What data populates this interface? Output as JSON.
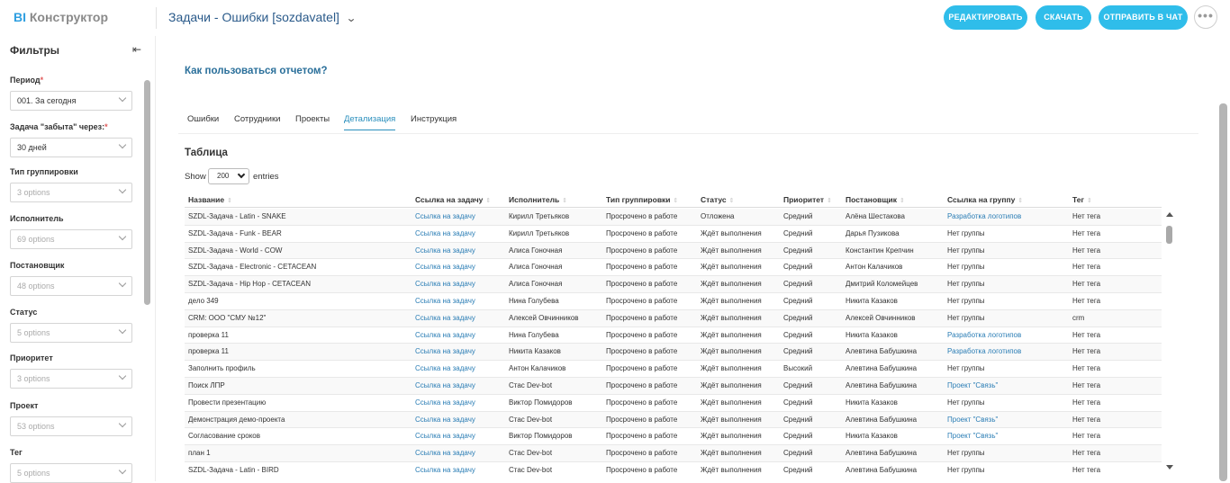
{
  "header": {
    "brand_bi": "BI",
    "brand_rest": " Конструктор",
    "report_title": "Задачи - Ошибки [sozdavatel]",
    "buttons": {
      "edit": "РЕДАКТИРОВАТЬ",
      "download": "СКАЧАТЬ",
      "send": "ОТПРАВИТЬ В ЧАТ"
    },
    "more": "•••"
  },
  "sidebar": {
    "title": "Фильтры",
    "filters": [
      {
        "label": "Период",
        "required": true,
        "value": "001. За сегодня",
        "placeholder": false
      },
      {
        "label": "Задача \"забыта\" через:",
        "required": true,
        "value": "30 дней",
        "placeholder": false
      },
      {
        "label": "Тип группировки",
        "required": false,
        "value": "3 options",
        "placeholder": true
      },
      {
        "label": "Исполнитель",
        "required": false,
        "value": "69 options",
        "placeholder": true
      },
      {
        "label": "Постановщик",
        "required": false,
        "value": "48 options",
        "placeholder": true
      },
      {
        "label": "Статус",
        "required": false,
        "value": "5 options",
        "placeholder": true
      },
      {
        "label": "Приоритет",
        "required": false,
        "value": "3 options",
        "placeholder": true
      },
      {
        "label": "Проект",
        "required": false,
        "value": "53 options",
        "placeholder": true
      },
      {
        "label": "Тег",
        "required": false,
        "value": "5 options",
        "placeholder": true
      }
    ]
  },
  "main": {
    "howto": "Как пользоваться отчетом?",
    "tabs": [
      {
        "label": "Ошибки",
        "active": false
      },
      {
        "label": "Сотрудники",
        "active": false
      },
      {
        "label": "Проекты",
        "active": false
      },
      {
        "label": "Детализация",
        "active": true
      },
      {
        "label": "Инструкция",
        "active": false
      }
    ],
    "table_title": "Таблица",
    "show_label": "Show",
    "show_value": "200",
    "entries_label": "entries",
    "columns": [
      "Название",
      "Ссылка на задачу",
      "Исполнитель",
      "Тип группировки",
      "Статус",
      "Приоритет",
      "Постановщик",
      "Ссылка на группу",
      "Тег"
    ],
    "rows": [
      [
        "SZDL-Задача - Latin - SNAKE",
        "Ссылка на задачу",
        "Кирилл Третьяков",
        "Просрочено в работе",
        "Отложена",
        "Средний",
        "Алёна Шестакова",
        "Разработка логотипов",
        "Нет тега"
      ],
      [
        "SZDL-Задача - Funk - BEAR",
        "Ссылка на задачу",
        "Кирилл Третьяков",
        "Просрочено в работе",
        "Ждёт выполнения",
        "Средний",
        "Дарья Пузикова",
        "Нет группы",
        "Нет тега"
      ],
      [
        "SZDL-Задача - World - COW",
        "Ссылка на задачу",
        "Алиса Гоночная",
        "Просрочено в работе",
        "Ждёт выполнения",
        "Средний",
        "Константин Крепчин",
        "Нет группы",
        "Нет тега"
      ],
      [
        "SZDL-Задача - Electronic - CETACEAN",
        "Ссылка на задачу",
        "Алиса Гоночная",
        "Просрочено в работе",
        "Ждёт выполнения",
        "Средний",
        "Антон Калачиков",
        "Нет группы",
        "Нет тега"
      ],
      [
        "SZDL-Задача - Hip Hop - CETACEAN",
        "Ссылка на задачу",
        "Алиса Гоночная",
        "Просрочено в работе",
        "Ждёт выполнения",
        "Средний",
        "Дмитрий Коломейцев",
        "Нет группы",
        "Нет тега"
      ],
      [
        "дело 349",
        "Ссылка на задачу",
        "Нина Голубева",
        "Просрочено в работе",
        "Ждёт выполнения",
        "Средний",
        "Никита Казаков",
        "Нет группы",
        "Нет тега"
      ],
      [
        "CRM: ООО \"СМУ №12\"",
        "Ссылка на задачу",
        "Алексей Овчинников",
        "Просрочено в работе",
        "Ждёт выполнения",
        "Средний",
        "Алексей Овчинников",
        "Нет группы",
        "crm"
      ],
      [
        "проверка 11",
        "Ссылка на задачу",
        "Нина Голубева",
        "Просрочено в работе",
        "Ждёт выполнения",
        "Средний",
        "Никита Казаков",
        "Разработка логотипов",
        "Нет тега"
      ],
      [
        "проверка 11",
        "Ссылка на задачу",
        "Никита Казаков",
        "Просрочено в работе",
        "Ждёт выполнения",
        "Средний",
        "Алевтина Бабушкина",
        "Разработка логотипов",
        "Нет тега"
      ],
      [
        "Заполнить профиль",
        "Ссылка на задачу",
        "Антон Калачиков",
        "Просрочено в работе",
        "Ждёт выполнения",
        "Высокий",
        "Алевтина Бабушкина",
        "Нет группы",
        "Нет тега"
      ],
      [
        "Поиск ЛПР",
        "Ссылка на задачу",
        "Стас Dev-bot",
        "Просрочено в работе",
        "Ждёт выполнения",
        "Средний",
        "Алевтина Бабушкина",
        "Проект \"Связь\"",
        "Нет тега"
      ],
      [
        "Провести презентацию",
        "Ссылка на задачу",
        "Виктор Помидоров",
        "Просрочено в работе",
        "Ждёт выполнения",
        "Средний",
        "Никита Казаков",
        "Нет группы",
        "Нет тега"
      ],
      [
        "Демонстрация демо-проекта",
        "Ссылка на задачу",
        "Стас Dev-bot",
        "Просрочено в работе",
        "Ждёт выполнения",
        "Средний",
        "Алевтина Бабушкина",
        "Проект \"Связь\"",
        "Нет тега"
      ],
      [
        "Согласование сроков",
        "Ссылка на задачу",
        "Виктор Помидоров",
        "Просрочено в работе",
        "Ждёт выполнения",
        "Средний",
        "Никита Казаков",
        "Проект \"Связь\"",
        "Нет тега"
      ],
      [
        "план 1",
        "Ссылка на задачу",
        "Стас Dev-bot",
        "Просрочено в работе",
        "Ждёт выполнения",
        "Средний",
        "Алевтина Бабушкина",
        "Нет группы",
        "Нет тега"
      ],
      [
        "SZDL-Задача - Latin - BIRD",
        "Ссылка на задачу",
        "Стас Dev-bot",
        "Просрочено в работе",
        "Ждёт выполнения",
        "Средний",
        "Алевтина Бабушкина",
        "Нет группы",
        "Нет тега"
      ]
    ],
    "link_columns": [
      1
    ],
    "link_group_values": [
      "Разработка логотипов",
      "Проект \"Связь\""
    ]
  },
  "colors": {
    "accent": "#2fbdea",
    "link": "#2a7db5",
    "title": "#2a5a8a"
  }
}
